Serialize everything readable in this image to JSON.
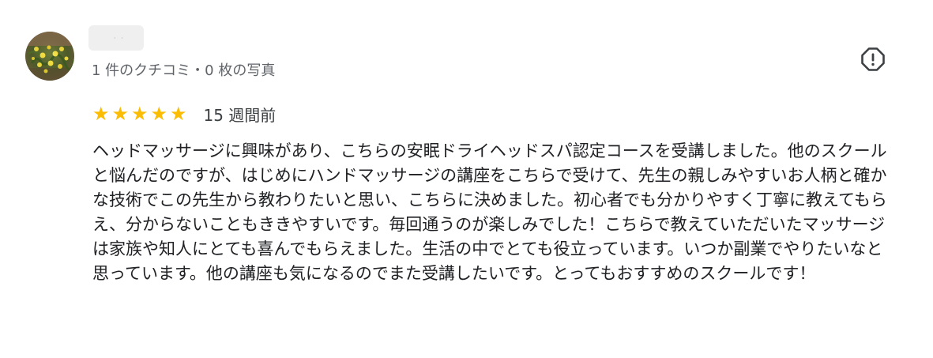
{
  "reviewer": {
    "name_placeholder": "· ·",
    "meta": "1 件のクチコミ・0 枚の写真"
  },
  "review": {
    "rating": 5,
    "rating_max": 5,
    "stars": [
      "★",
      "★",
      "★",
      "★",
      "★"
    ],
    "time_ago": "15 週間前",
    "text": "ヘッドマッサージに興味があり、こちらの安眠ドライヘッドスパ認定コースを受講しました。他のスクールと悩んだのですが、はじめにハンドマッサージの講座をこちらで受けて、先生の親しみやすいお人柄と確かな技術でこの先生から教わりたいと思い、こちらに決めました。初心者でも分かりやすく丁寧に教えてもらえ、分からないこともききやすいです。毎回通うのが楽しみでした！こちらで教えていただいたマッサージは家族や知人にとても喜んでもらえました。生活の中でとても役立っています。いつか副業でやりたいなと思っています。他の講座も気になるのでまた受講したいです。とってもおすすめのスクールです！"
  },
  "icons": {
    "avatar": "avatar-photo-flowers",
    "flag": "report-flag-icon"
  },
  "colors": {
    "star": "#fbbc04",
    "meta_text": "#5f6368",
    "body_text": "#202124"
  }
}
